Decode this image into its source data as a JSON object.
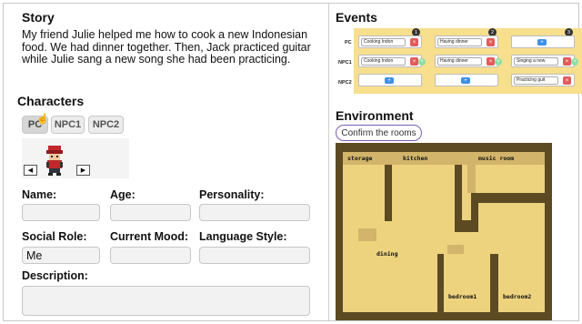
{
  "story": {
    "heading": "Story",
    "text": "My friend Julie helped me how to cook a new Indonesian food. We had dinner together. Then,  Jack practiced guitar while Julie sang  a new song she had been practicing."
  },
  "characters": {
    "heading": "Characters",
    "tabs": [
      "PC",
      "NPC1",
      "NPC2"
    ],
    "active_tab": "PC",
    "prev_arrow": "◀",
    "next_arrow": "▶",
    "fields": {
      "name_label": "Name:",
      "name_value": "",
      "age_label": "Age:",
      "age_value": "",
      "personality_label": "Personality:",
      "personality_value": "",
      "social_role_label": "Social Role:",
      "social_role_value": "Me",
      "mood_label": "Current Mood:",
      "mood_value": "",
      "language_label": "Language Style:",
      "language_value": "",
      "description_label": "Description:",
      "description_value": ""
    }
  },
  "events": {
    "heading": "Events",
    "row_labels": [
      "PC",
      "NPC1",
      "NPC2"
    ],
    "columns": [
      {
        "number": "1",
        "pc": "Cooking Indon",
        "npc1": "Cooking Indon",
        "npc2": ""
      },
      {
        "number": "2",
        "pc": "Having dinner",
        "npc1": "Having dinner",
        "npc2": ""
      },
      {
        "number": "3",
        "pc": "",
        "npc1": "Singing a new",
        "npc2": "Practicing guit"
      }
    ],
    "delete_glyph": "×",
    "add_glyph": "+",
    "plus_glyph": "+"
  },
  "environment": {
    "heading": "Environment",
    "confirm_label": "Confirm the rooms",
    "rooms": {
      "storage": "storage",
      "kitchen": "kitchen",
      "music": "music room",
      "dining": "dining",
      "bedroom1": "bedroom1",
      "bedroom2": "bedroom2"
    }
  },
  "colors": {
    "event_cell": "#f7df8d",
    "map_wall": "#5c4a22",
    "map_floor": "#eed37f",
    "confirm_border": "#7a5fb0",
    "delete_red": "#e35b5b",
    "add_blue": "#3f8fe6",
    "plus_green": "#8ddfa5"
  },
  "icons": {
    "cursor": "hand-pointer-icon",
    "sprite": "character-sprite-icon"
  }
}
